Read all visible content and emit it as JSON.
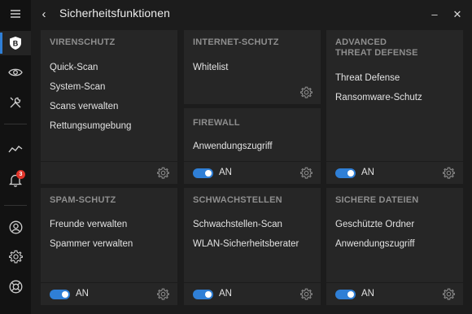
{
  "window": {
    "title": "Sicherheitsfunktionen",
    "back_icon": "‹",
    "minimize_icon": "‒",
    "close_icon": "✕"
  },
  "sidebar": {
    "items": [
      {
        "name": "menu",
        "icon": "hamburger-icon"
      },
      {
        "name": "dashboard",
        "icon": "bitdefender-logo-icon",
        "active": true
      },
      {
        "name": "privacy",
        "icon": "eye-icon"
      },
      {
        "name": "utilities",
        "icon": "tools-icon"
      },
      {
        "name": "activity",
        "icon": "activity-icon"
      },
      {
        "name": "notifications",
        "icon": "bell-icon",
        "badge": "3"
      },
      {
        "name": "account",
        "icon": "user-icon"
      },
      {
        "name": "settings",
        "icon": "gear-icon"
      },
      {
        "name": "support",
        "icon": "lifebuoy-icon"
      }
    ]
  },
  "cards": {
    "virenschutz": {
      "title": "VIRENSCHUTZ",
      "items": [
        "Quick-Scan",
        "System-Scan",
        "Scans verwalten",
        "Rettungsumgebung"
      ]
    },
    "internet": {
      "title": "INTERNET-SCHUTZ",
      "items": [
        "Whitelist"
      ]
    },
    "firewall": {
      "title": "FIREWALL",
      "items": [
        "Anwendungszugriff"
      ],
      "toggle_label": "AN"
    },
    "atd": {
      "title": "ADVANCED THREAT DEFENSE",
      "items": [
        "Threat Defense",
        "Ransomware-Schutz"
      ],
      "toggle_label": "AN"
    },
    "spam": {
      "title": "SPAM-SCHUTZ",
      "items": [
        "Freunde verwalten",
        "Spammer verwalten"
      ],
      "toggle_label": "AN"
    },
    "schwachstellen": {
      "title": "SCHWACHSTELLEN",
      "items": [
        "Schwachstellen-Scan",
        "WLAN-Sicherheitsberater"
      ],
      "toggle_label": "AN"
    },
    "dateien": {
      "title": "SICHERE DATEIEN",
      "items": [
        "Geschützte Ordner",
        "Anwendungszugriff"
      ],
      "toggle_label": "AN"
    }
  },
  "colors": {
    "accent": "#2f7fd6",
    "badge": "#e0352b",
    "card_bg": "#262626",
    "app_bg": "#1c1c1c",
    "sidebar_bg": "#121212"
  }
}
